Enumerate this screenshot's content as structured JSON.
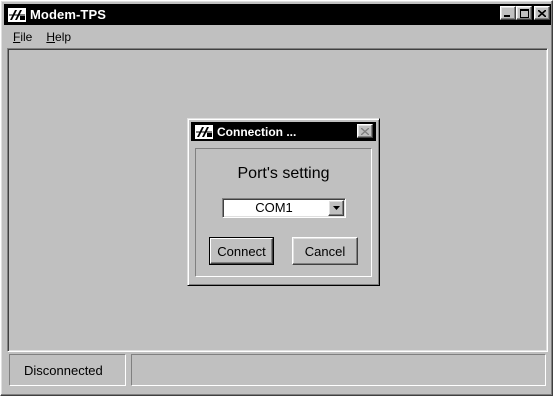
{
  "window": {
    "title": "Modem-TPS",
    "icon": "modem-app-icon",
    "controls": [
      "minimize",
      "maximize",
      "close"
    ]
  },
  "menu": {
    "items": [
      {
        "label": "File",
        "accel": "F",
        "rest": "ile"
      },
      {
        "label": "Help",
        "accel": "H",
        "rest": "elp"
      }
    ]
  },
  "dialog": {
    "title": "Connection ...",
    "heading": "Port's setting",
    "port": {
      "selected": "COM1"
    },
    "connect_label": "Connect",
    "cancel_label": "Cancel"
  },
  "status": {
    "connection": "Disconnected",
    "message": ""
  }
}
